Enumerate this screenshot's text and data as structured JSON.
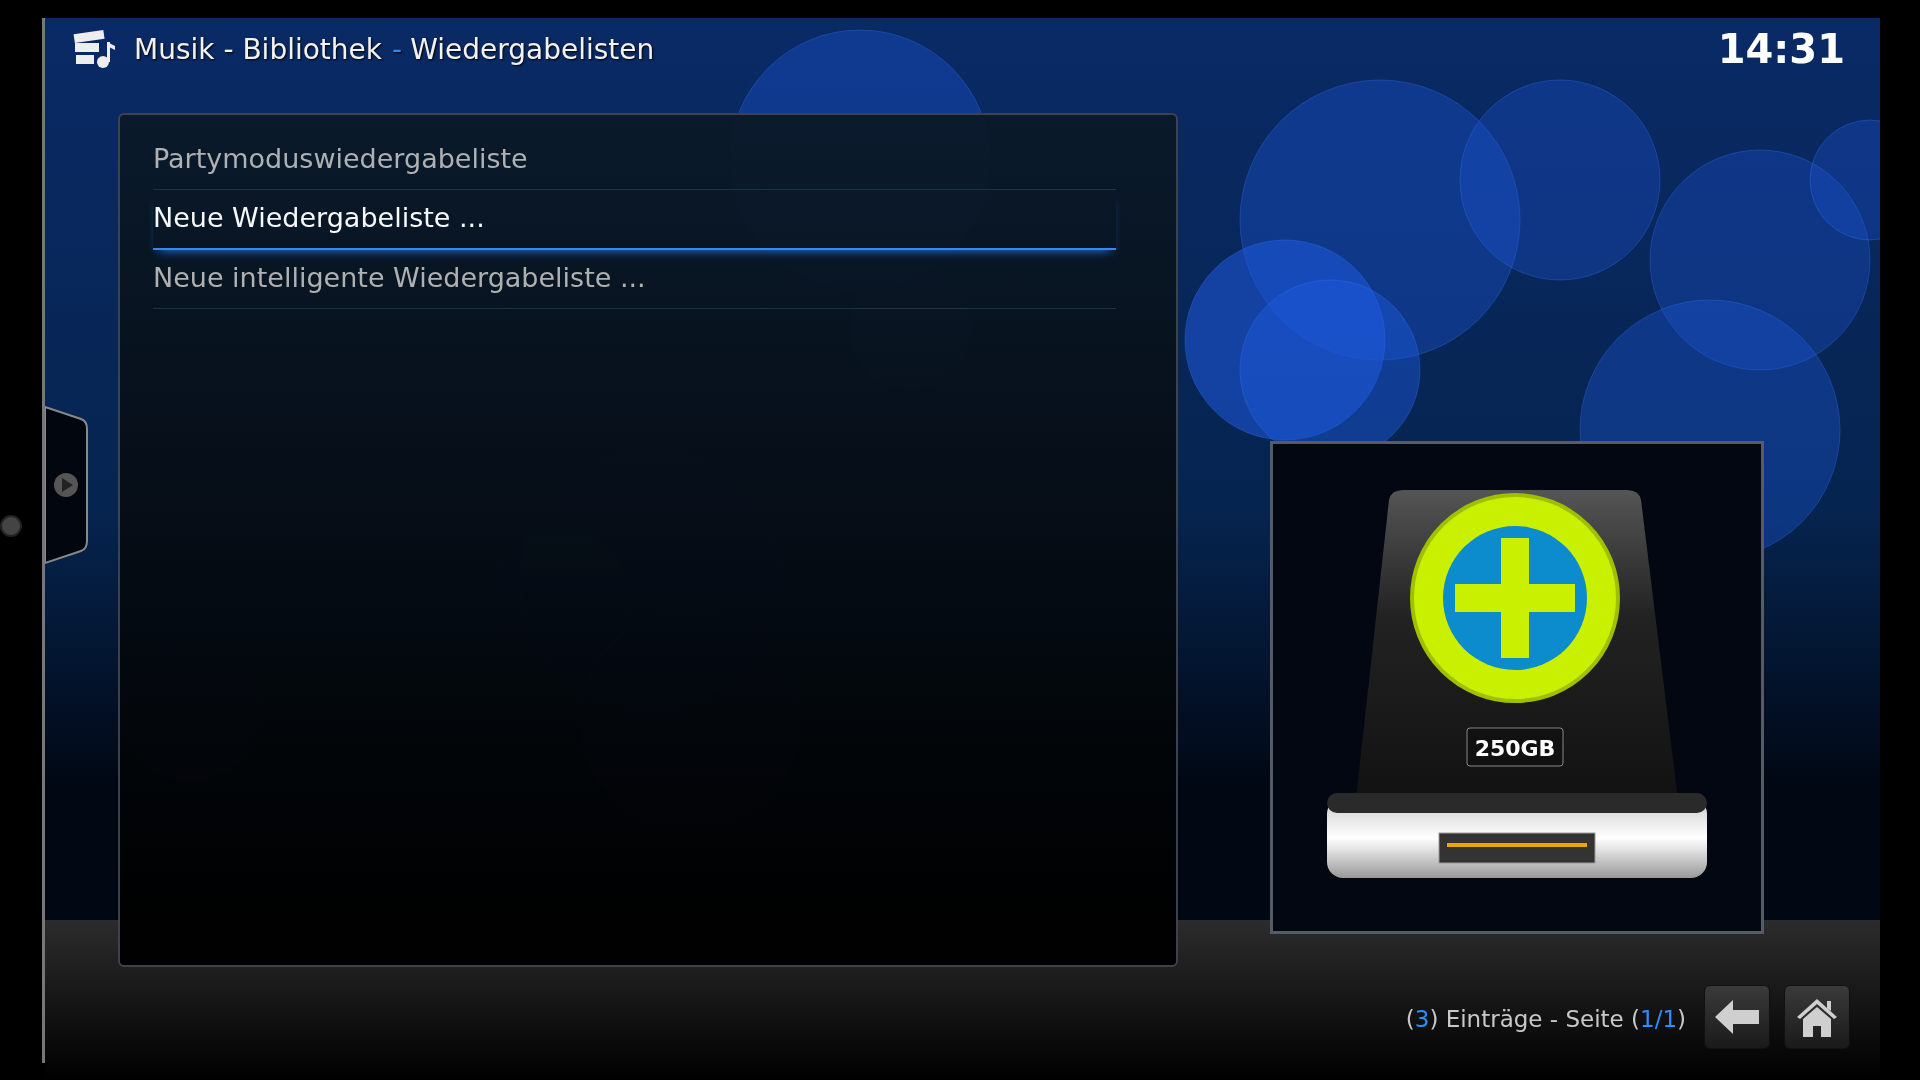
{
  "header": {
    "section": "Musik - Bibliothek",
    "separator": "-",
    "page": "Wiedergabelisten",
    "clock": "14:31"
  },
  "list": {
    "items": [
      {
        "label": "Partymoduswiedergabeliste",
        "selected": false
      },
      {
        "label": "Neue Wiedergabeliste ...",
        "selected": true
      },
      {
        "label": "Neue intelligente Wiedergabeliste ...",
        "selected": false
      }
    ]
  },
  "thumbnail": {
    "label": "250GB"
  },
  "footer": {
    "parts": [
      {
        "text": "(",
        "accent": false
      },
      {
        "text": "3",
        "accent": true
      },
      {
        "text": ") Einträge - Seite (",
        "accent": false
      },
      {
        "text": "1/1",
        "accent": true
      },
      {
        "text": ")",
        "accent": false
      }
    ],
    "buttons": [
      {
        "kind": "back"
      },
      {
        "kind": "home"
      }
    ]
  }
}
